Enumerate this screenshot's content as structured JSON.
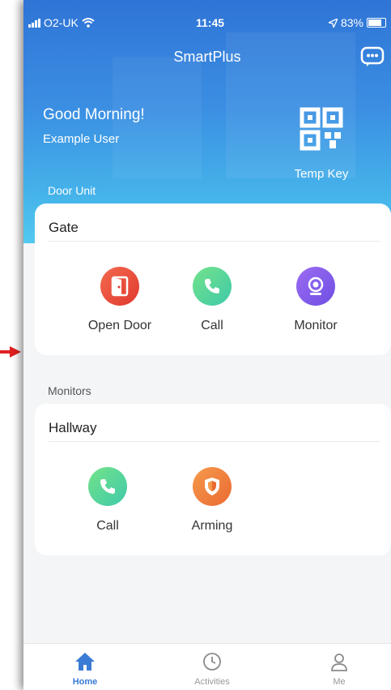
{
  "status_bar": {
    "carrier": "O2-UK",
    "time": "11:45",
    "battery": "83%"
  },
  "header": {
    "title": "SmartPlus",
    "chat_icon": "chat-bubble-icon"
  },
  "greeting": {
    "salutation": "Good Morning!",
    "user": "Example User"
  },
  "temp_key": {
    "label": "Temp Key",
    "icon": "qr-code-icon"
  },
  "door_unit": {
    "section_label": "Door Unit",
    "device_name": "Gate",
    "actions": [
      {
        "label": "Open Door",
        "icon": "door-icon",
        "color": "#e8473a"
      },
      {
        "label": "Call",
        "icon": "phone-icon",
        "color": "#52d69a"
      },
      {
        "label": "Monitor",
        "icon": "camera-icon",
        "color": "#7c58ea"
      }
    ]
  },
  "monitors": {
    "section_label": "Monitors",
    "device_name": "Hallway",
    "actions": [
      {
        "label": "Call",
        "icon": "phone-icon",
        "color": "#52d69a"
      },
      {
        "label": "Arming",
        "icon": "shield-icon",
        "color": "#ef7a3a"
      }
    ]
  },
  "tabs": [
    {
      "label": "Home",
      "icon": "home-icon",
      "active": true
    },
    {
      "label": "Activities",
      "icon": "clock-icon",
      "active": false
    },
    {
      "label": "Me",
      "icon": "person-icon",
      "active": false
    }
  ],
  "colors": {
    "accent": "#3a7bd5",
    "pointer": "#e02020"
  }
}
